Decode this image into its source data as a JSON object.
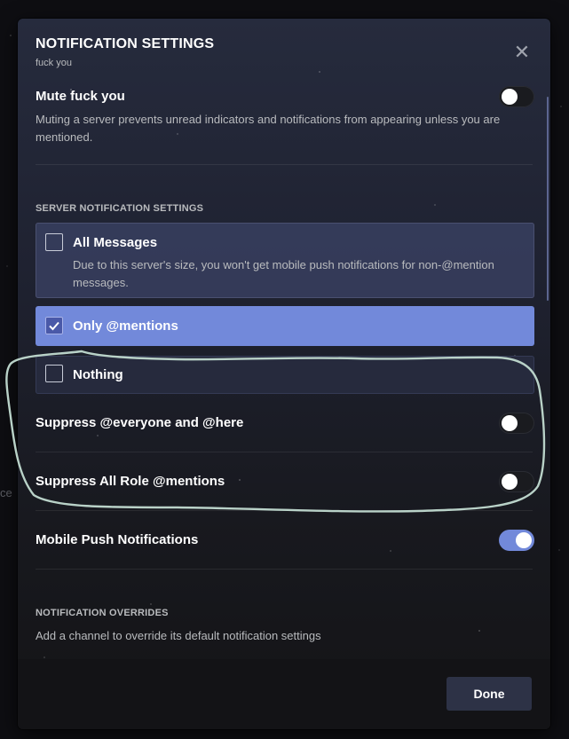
{
  "background": {
    "fragment_text": "ce"
  },
  "modal": {
    "title": "NOTIFICATION SETTINGS",
    "subtitle": "fuck you",
    "close_icon": "close-icon"
  },
  "mute": {
    "label": "Mute fuck you",
    "description": "Muting a server prevents unread indicators and notifications from appearing unless you are mentioned.",
    "enabled": false
  },
  "server_notifications": {
    "section_title": "SERVER NOTIFICATION SETTINGS",
    "options": [
      {
        "label": "All Messages",
        "description": "Due to this server's size, you won't get mobile push notifications for non-@mention messages.",
        "checked": false
      },
      {
        "label": "Only @mentions",
        "checked": true
      },
      {
        "label": "Nothing",
        "checked": false
      }
    ]
  },
  "toggles": [
    {
      "label": "Suppress @everyone and @here",
      "enabled": false
    },
    {
      "label": "Suppress All Role @mentions",
      "enabled": false
    },
    {
      "label": "Mobile Push Notifications",
      "enabled": true
    }
  ],
  "overrides": {
    "section_title": "NOTIFICATION OVERRIDES",
    "description": "Add a channel to override its default notification settings"
  },
  "footer": {
    "done_label": "Done"
  },
  "colors": {
    "accent": "#7289da",
    "annotation_stroke": "#b9d2c8"
  }
}
